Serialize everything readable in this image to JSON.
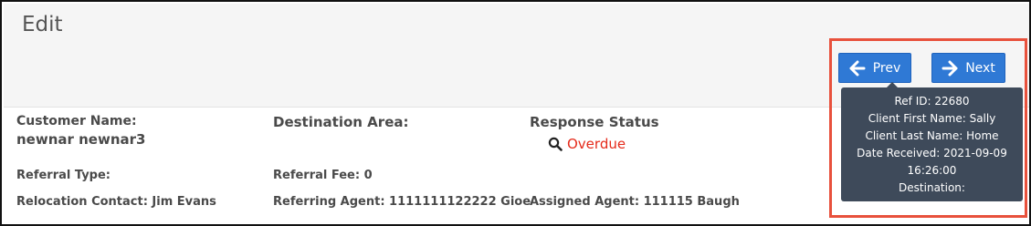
{
  "page": {
    "title": "Edit"
  },
  "nav": {
    "prev_label": "Prev",
    "next_label": "Next",
    "button_color": "#2f79d5",
    "highlight_color": "#e8513c"
  },
  "fields": {
    "customer_name_label": "Customer Name:",
    "customer_name_value": "newnar newnar3",
    "destination_area_label": "Destination Area:",
    "response_status_label": "Response Status",
    "response_status_value": "Overdue",
    "status_color": "#e52a1a",
    "referral_type": "Referral Type:",
    "referral_fee": "Referral Fee: 0",
    "relocation_contact": "Relocation Contact: Jim Evans",
    "referring_agent": "Referring Agent: 1111111122222 Gioe",
    "assigned_agent": "Assigned Agent: 111115 Baugh"
  },
  "tooltip": {
    "ref_id": "Ref ID: 22680",
    "client_first_name": "Client First Name: Sally",
    "client_last_name": "Client Last Name: Home",
    "date_received": "Date Received: 2021-09-09",
    "time_received": "16:26:00",
    "destination": "Destination:"
  },
  "icons": {
    "prev": "arrow-left-icon",
    "next": "arrow-right-icon",
    "status": "magnifier-icon"
  }
}
